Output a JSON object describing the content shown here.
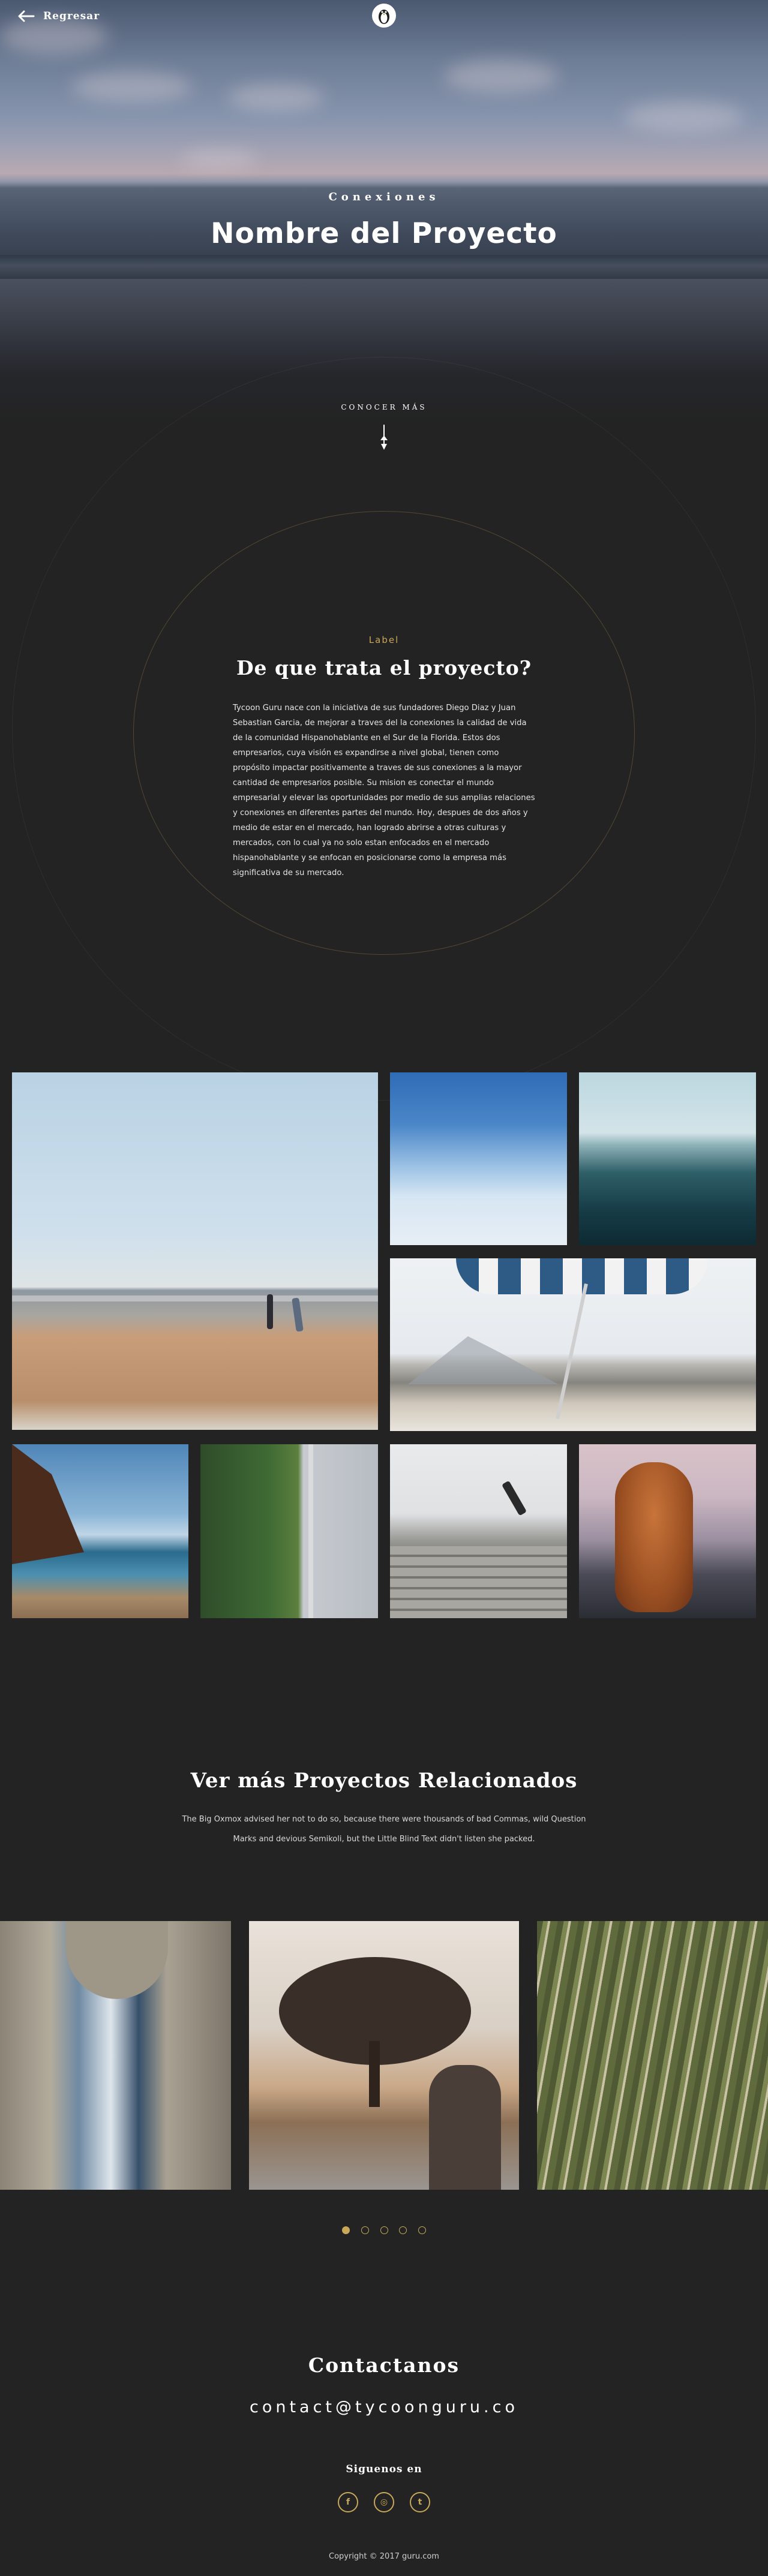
{
  "nav": {
    "back_label": "Regresar",
    "logo_icon": "penguin-logo-icon"
  },
  "hero": {
    "eyebrow": "Conexiones",
    "title": "Nombre del Proyecto",
    "scroll_label": "CONOCER MÁS"
  },
  "about": {
    "label": "Label",
    "title": "De que trata el proyecto?",
    "body": "Tycoon Guru nace con la iniciativa de sus fundadores Diego Diaz y Juan Sebastian Garcia, de mejorar a traves del la conexiones la calidad de vida de la comunidad Hispanohablante en el Sur de la Florida. Estos dos empresarios, cuya visión es expandirse a nivel global, tienen como propósito impactar positivamente a traves de sus conexiones a la mayor cantidad de empresarios posible. Su mision es conectar el mundo empresarial y elevar las oportunidades por medio de sus amplias relaciones y conexiones en diferentes partes del mundo. Hoy, despues de dos años y medio de estar en el mercado, han logrado abrirse a otras culturas y mercados, con lo cual ya no solo estan enfocados en el mercado hispanohablante y se enfocan en posicionarse como la empresa más significativa de su mercado."
  },
  "gallery": {
    "images": [
      "beach-couple-photo",
      "sky-clouds-photo",
      "surfer-water-photo",
      "beach-umbrella-photo",
      "coast-cliff-photo",
      "aerial-forest-road-photo",
      "skatepark-stairs-photo",
      "dog-beach-photo"
    ]
  },
  "related": {
    "title": "Ver más Proyectos Relacionados",
    "text": "The Big Oxmox advised her not to do so, because there were thousands of bad Commas, wild Question Marks and devious Semikoli, but the Little Blind Text didn't listen she packed.",
    "cards": [
      "rock-arch-photo",
      "tree-photographer-photo",
      "grass-plants-photo"
    ],
    "dots": 5,
    "active_dot": 0
  },
  "contact": {
    "title": "Contactanos",
    "email": "contact@tycoonguru.co",
    "follow_label": "Siguenos en",
    "socials": [
      {
        "name": "facebook-icon",
        "glyph": "f"
      },
      {
        "name": "instagram-icon",
        "glyph": "◎"
      },
      {
        "name": "twitter-icon",
        "glyph": "t"
      }
    ]
  },
  "footer": {
    "copyright": "Copyright © 2017 guru.com"
  },
  "colors": {
    "background": "#232323",
    "accent": "#c9a85a",
    "text": "#ffffff"
  }
}
